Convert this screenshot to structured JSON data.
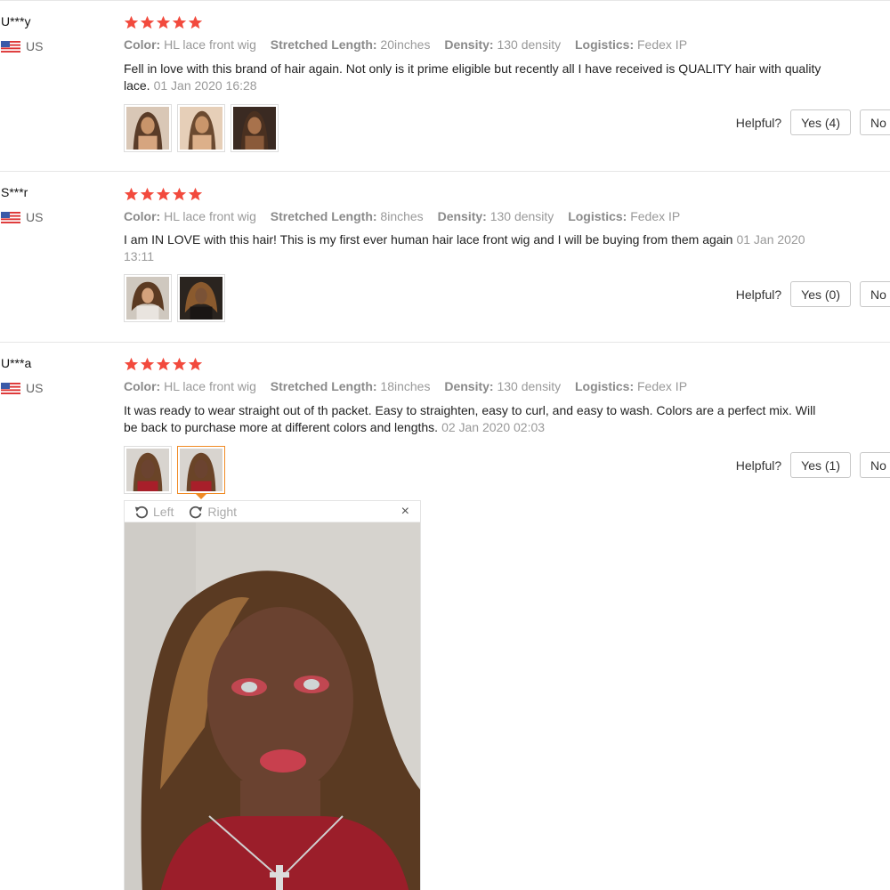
{
  "colors": {
    "star": "#f24a3d",
    "accent": "#f08a24",
    "muted": "#999999"
  },
  "labels": {
    "color": "Color:",
    "stretched_length": "Stretched Length:",
    "density": "Density:",
    "logistics": "Logistics:",
    "helpful": "Helpful?",
    "no": "No"
  },
  "reviews": [
    {
      "user": "U***y",
      "country": "US",
      "rating": 5,
      "color": "HL lace front wig",
      "stretched_length": "20inches",
      "density": "130 density",
      "logistics": "Fedex IP",
      "text": "Fell in love with this brand of hair again. Not only is it prime eligible but recently all I have received is QUALITY hair with quality lace.",
      "date": "01 Jan 2020 16:28",
      "yes": "Yes (4)",
      "photo_count": 3
    },
    {
      "user": "S***r",
      "country": "US",
      "rating": 5,
      "color": "HL lace front wig",
      "stretched_length": "8inches",
      "density": "130 density",
      "logistics": "Fedex IP",
      "text": "I am IN LOVE with this hair! This is my first ever human hair lace front wig and I will be buying from them again",
      "date": "01 Jan 2020 13:11",
      "yes": "Yes (0)",
      "photo_count": 2
    },
    {
      "user": "U***a",
      "country": "US",
      "rating": 5,
      "color": "HL lace front wig",
      "stretched_length": "18inches",
      "density": "130 density",
      "logistics": "Fedex IP",
      "text": "It was ready to wear straight out of th packet. Easy to straighten, easy to curl, and easy to wash. Colors are a perfect mix. Will be back to purchase more at different colors and lengths.",
      "date": "02 Jan 2020 02:03",
      "yes": "Yes (1)",
      "photo_count": 2
    }
  ],
  "viewer": {
    "rotate_left": "Left",
    "rotate_right": "Right",
    "close": "×"
  }
}
